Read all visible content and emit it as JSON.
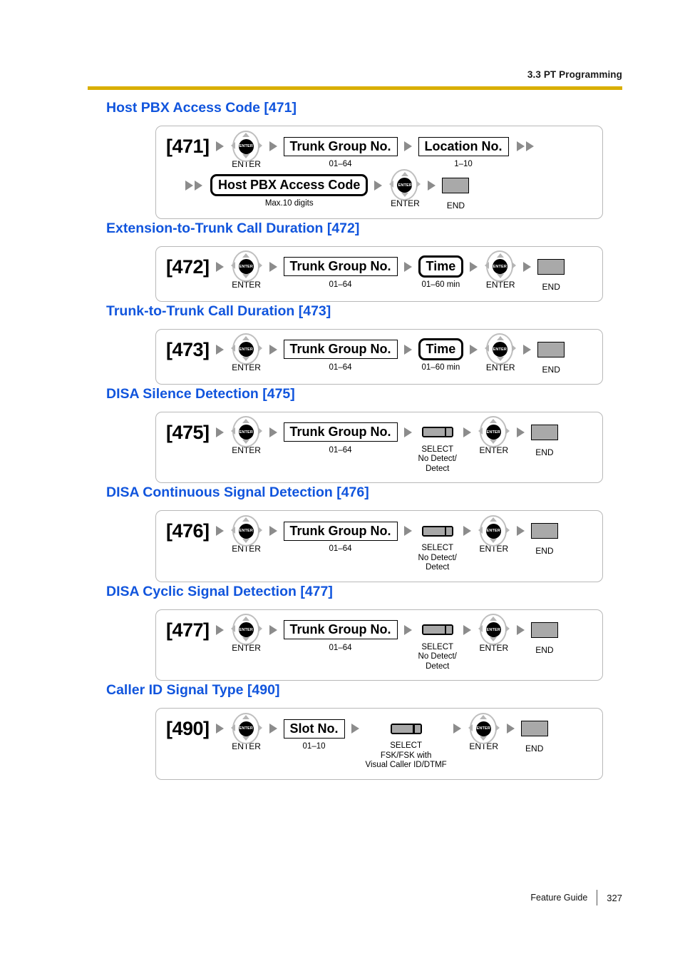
{
  "header": {
    "title": "3.3 PT Programming",
    "rule_color": "#d9ae00"
  },
  "theme": {
    "heading_color": "#1155dd",
    "arrow_color": "#8c8c8c",
    "key_gray": "#a9a9a9"
  },
  "labels": {
    "enter": "ENTER",
    "end": "END",
    "select": "SELECT"
  },
  "sections": [
    {
      "heading": "Host PBX Access Code [471]",
      "heading_name": "Host PBX Access Code",
      "heading_code": "[471]",
      "prog_code": "[471]",
      "rows": [
        {
          "steps": [
            {
              "type": "nav",
              "label": "ENTER"
            },
            {
              "type": "param",
              "style": "square",
              "label": "Trunk Group No.",
              "caption": "01–64"
            },
            {
              "type": "param",
              "style": "square",
              "label": "Location No.",
              "caption": "1–10"
            }
          ],
          "trailing": "double-arrow"
        },
        {
          "leading": "double-arrow",
          "steps": [
            {
              "type": "param",
              "style": "rounded",
              "label": "Host PBX Access Code",
              "caption": "Max.10 digits"
            },
            {
              "type": "nav",
              "label": "ENTER"
            },
            {
              "type": "end",
              "label": "END"
            }
          ]
        }
      ]
    },
    {
      "heading": "Extension-to-Trunk Call Duration [472]",
      "heading_name": "Extension-to-Trunk Call Duration",
      "heading_code": "[472]",
      "prog_code": "[472]",
      "rows": [
        {
          "steps": [
            {
              "type": "nav",
              "label": "ENTER"
            },
            {
              "type": "param",
              "style": "square",
              "label": "Trunk Group No.",
              "caption": "01–64"
            },
            {
              "type": "param",
              "style": "rounded",
              "label": "Time",
              "caption": "01–60 min"
            },
            {
              "type": "nav",
              "label": "ENTER"
            },
            {
              "type": "end",
              "label": "END"
            }
          ]
        }
      ]
    },
    {
      "heading": "Trunk-to-Trunk Call Duration [473]",
      "heading_name": "Trunk-to-Trunk Call Duration",
      "heading_code": "[473]",
      "prog_code": "[473]",
      "rows": [
        {
          "steps": [
            {
              "type": "nav",
              "label": "ENTER"
            },
            {
              "type": "param",
              "style": "square",
              "label": "Trunk Group No.",
              "caption": "01–64"
            },
            {
              "type": "param",
              "style": "rounded",
              "label": "Time",
              "caption": "01–60 min"
            },
            {
              "type": "nav",
              "label": "ENTER"
            },
            {
              "type": "end",
              "label": "END"
            }
          ]
        }
      ]
    },
    {
      "heading": "DISA Silence Detection [475]",
      "heading_name": "DISA Silence Detection",
      "heading_code": "[475]",
      "prog_code": "[475]",
      "rows": [
        {
          "steps": [
            {
              "type": "nav",
              "label": "ENTER"
            },
            {
              "type": "param",
              "style": "square",
              "label": "Trunk Group No.",
              "caption": "01–64"
            },
            {
              "type": "select",
              "label": "SELECT",
              "options": "No Detect/\nDetect"
            },
            {
              "type": "nav",
              "label": "ENTER"
            },
            {
              "type": "end",
              "label": "END"
            }
          ]
        }
      ]
    },
    {
      "heading": "DISA Continuous Signal Detection [476]",
      "heading_name": "DISA Continuous Signal Detection",
      "heading_code": "[476]",
      "prog_code": "[476]",
      "rows": [
        {
          "steps": [
            {
              "type": "nav",
              "label": "ENTER"
            },
            {
              "type": "param",
              "style": "square",
              "label": "Trunk Group No.",
              "caption": "01–64"
            },
            {
              "type": "select",
              "label": "SELECT",
              "options": "No Detect/\nDetect"
            },
            {
              "type": "nav",
              "label": "ENTER"
            },
            {
              "type": "end",
              "label": "END"
            }
          ]
        }
      ]
    },
    {
      "heading": "DISA Cyclic Signal Detection [477]",
      "heading_name": "DISA Cyclic Signal Detection",
      "heading_code": "[477]",
      "prog_code": "[477]",
      "rows": [
        {
          "steps": [
            {
              "type": "nav",
              "label": "ENTER"
            },
            {
              "type": "param",
              "style": "square",
              "label": "Trunk Group No.",
              "caption": "01–64"
            },
            {
              "type": "select",
              "label": "SELECT",
              "options": "No Detect/\nDetect"
            },
            {
              "type": "nav",
              "label": "ENTER"
            },
            {
              "type": "end",
              "label": "END"
            }
          ]
        }
      ]
    },
    {
      "heading": "Caller ID Signal Type [490]",
      "heading_name": "Caller ID Signal Type",
      "heading_code": "[490]",
      "prog_code": "[490]",
      "rows": [
        {
          "steps": [
            {
              "type": "nav",
              "label": "ENTER"
            },
            {
              "type": "param",
              "style": "square",
              "label": "Slot No.",
              "caption": "01–10"
            },
            {
              "type": "select",
              "label": "SELECT",
              "options": "FSK/FSK with\nVisual Caller ID/DTMF"
            },
            {
              "type": "nav",
              "label": "ENTER"
            },
            {
              "type": "end",
              "label": "END"
            }
          ]
        }
      ]
    }
  ],
  "footer": {
    "guide": "Feature Guide",
    "page_number": "327"
  }
}
